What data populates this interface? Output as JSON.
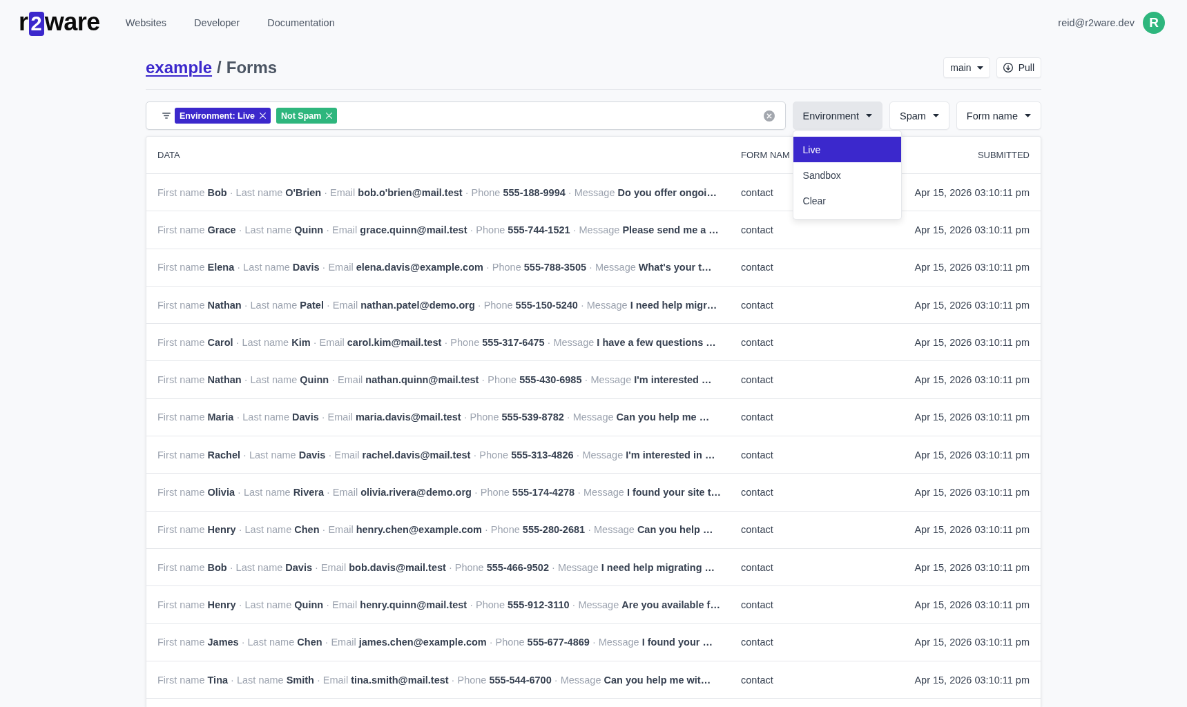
{
  "top_bar": {
    "logo": {
      "prefix": "r",
      "mark": "2",
      "suffix": "ware"
    },
    "nav": [
      "Websites",
      "Developer",
      "Documentation"
    ],
    "user": {
      "email": "reid@r2ware.dev",
      "avatar_initial": "R"
    }
  },
  "page_header": {
    "breadcrumb": [
      {
        "label": "example",
        "kind": "link"
      },
      {
        "label": "Forms",
        "kind": "current"
      }
    ],
    "separator": "/",
    "branch_button": "main",
    "pull_button": "Pull"
  },
  "filter_bar": {
    "chips": [
      {
        "label": "Environment: Live",
        "color": "#3b28cc"
      },
      {
        "label": "Not Spam",
        "color": "#2eb67d"
      }
    ]
  },
  "filters": [
    {
      "label": "Environment",
      "expanded": true,
      "options": [
        {
          "label": "Live",
          "selected": true
        },
        {
          "label": "Sandbox",
          "selected": false
        },
        {
          "label": "Clear",
          "selected": false
        }
      ]
    },
    {
      "label": "Spam",
      "expanded": false
    },
    {
      "label": "Form name",
      "expanded": false
    }
  ],
  "table": {
    "columns": [
      "DATA",
      "FORM NAM",
      "SUBMITTED"
    ],
    "rows": [
      {
        "data": "First name **Bob** · Last name **O'Brien** · Email **bob.o'brien@mail.test** · Phone **555-188-9994** · Message **Do you offer ongoi…**",
        "form_name": "contact",
        "submitted": "Apr 15, 2026 03:10:11 pm"
      },
      {
        "data": "First name **Grace** · Last name **Quinn** · Email **grace.quinn@mail.test** · Phone **555-744-1521** · Message **Please send me a …**",
        "form_name": "contact",
        "submitted": "Apr 15, 2026 03:10:11 pm"
      },
      {
        "data": "First name **Elena** · Last name **Davis** · Email **elena.davis@example.com** · Phone **555-788-3505** · Message **What's your t…**",
        "form_name": "contact",
        "submitted": "Apr 15, 2026 03:10:11 pm"
      },
      {
        "data": "First name **Nathan** · Last name **Patel** · Email **nathan.patel@demo.org** · Phone **555-150-5240** · Message **I need help migr…**",
        "form_name": "contact",
        "submitted": "Apr 15, 2026 03:10:11 pm"
      },
      {
        "data": "First name **Carol** · Last name **Kim** · Email **carol.kim@mail.test** · Phone **555-317-6475** · Message **I have a few questions …**",
        "form_name": "contact",
        "submitted": "Apr 15, 2026 03:10:11 pm"
      },
      {
        "data": "First name **Nathan** · Last name **Quinn** · Email **nathan.quinn@mail.test** · Phone **555-430-6985** · Message **I'm interested …**",
        "form_name": "contact",
        "submitted": "Apr 15, 2026 03:10:11 pm"
      },
      {
        "data": "First name **Maria** · Last name **Davis** · Email **maria.davis@mail.test** · Phone **555-539-8782** · Message **Can you help me …**",
        "form_name": "contact",
        "submitted": "Apr 15, 2026 03:10:11 pm"
      },
      {
        "data": "First name **Rachel** · Last name **Davis** · Email **rachel.davis@mail.test** · Phone **555-313-4826** · Message **I'm interested in …**",
        "form_name": "contact",
        "submitted": "Apr 15, 2026 03:10:11 pm"
      },
      {
        "data": "First name **Olivia** · Last name **Rivera** · Email **olivia.rivera@demo.org** · Phone **555-174-4278** · Message **I found your site t…**",
        "form_name": "contact",
        "submitted": "Apr 15, 2026 03:10:11 pm"
      },
      {
        "data": "First name **Henry** · Last name **Chen** · Email **henry.chen@example.com** · Phone **555-280-2681** · Message **Can you help …**",
        "form_name": "contact",
        "submitted": "Apr 15, 2026 03:10:11 pm"
      },
      {
        "data": "First name **Bob** · Last name **Davis** · Email **bob.davis@mail.test** · Phone **555-466-9502** · Message **I need help migrating …**",
        "form_name": "contact",
        "submitted": "Apr 15, 2026 03:10:11 pm"
      },
      {
        "data": "First name **Henry** · Last name **Quinn** · Email **henry.quinn@mail.test** · Phone **555-912-3110** · Message **Are you available f…**",
        "form_name": "contact",
        "submitted": "Apr 15, 2026 03:10:11 pm"
      },
      {
        "data": "First name **James** · Last name **Chen** · Email **james.chen@example.com** · Phone **555-677-4869** · Message **I found your …**",
        "form_name": "contact",
        "submitted": "Apr 15, 2026 03:10:11 pm"
      },
      {
        "data": "First name **Tina** · Last name **Smith** · Email **tina.smith@mail.test** · Phone **555-544-6700** · Message **Can you help me wit…**",
        "form_name": "contact",
        "submitted": "Apr 15, 2026 03:10:11 pm"
      }
    ]
  }
}
